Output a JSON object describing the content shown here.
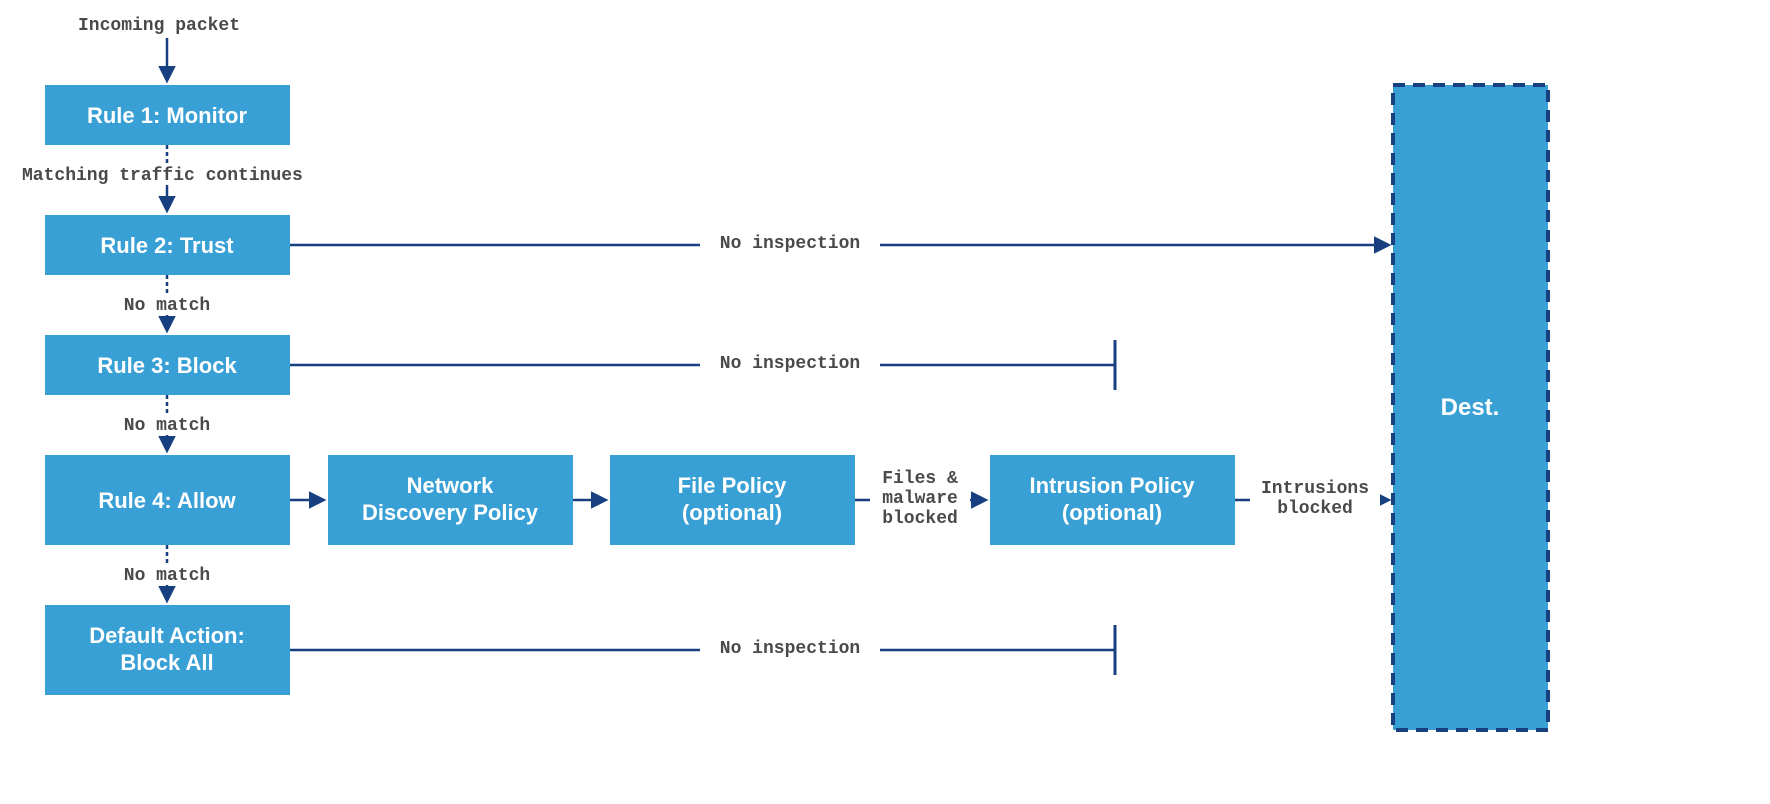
{
  "labels": {
    "incoming": "Incoming packet",
    "matchingContinues": "Matching traffic continues",
    "noMatch1": "No match",
    "noMatch2": "No match",
    "noMatch3": "No match",
    "noInspection1": "No inspection",
    "noInspection2": "No inspection",
    "noInspection3": "No inspection",
    "filesMalware1": "Files &",
    "filesMalware2": "malware",
    "filesMalware3": "blocked",
    "intrusions1": "Intrusions",
    "intrusions2": "blocked"
  },
  "boxes": {
    "rule1": "Rule 1: Monitor",
    "rule2": "Rule 2: Trust",
    "rule3": "Rule 3: Block",
    "rule4": "Rule 4: Allow",
    "default1": "Default Action:",
    "default2": "Block All",
    "network1": "Network",
    "network2": "Discovery Policy",
    "file1": "File Policy",
    "file2": "(optional)",
    "intrusion1": "Intrusion Policy",
    "intrusion2": "(optional)",
    "dest": "Dest."
  },
  "colors": {
    "boxFill": "#39a0d6",
    "line": "#183f80"
  }
}
